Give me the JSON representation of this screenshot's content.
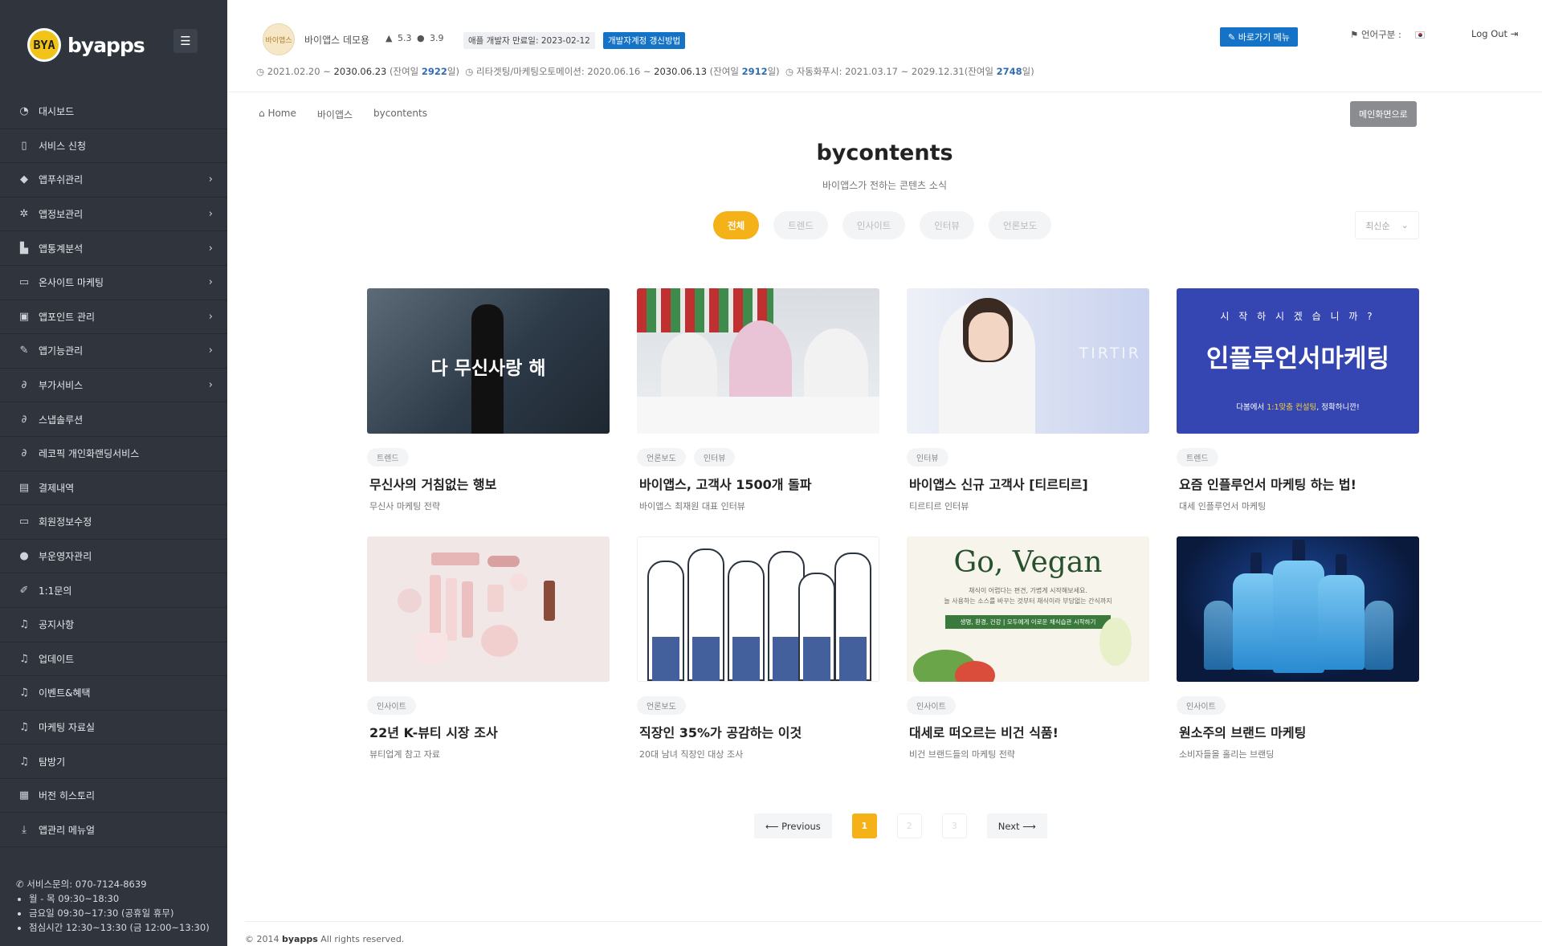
{
  "brand": {
    "logo_mark": "BYA",
    "logo_text": "byapps"
  },
  "sidebar": {
    "items": [
      {
        "label": "대시보드",
        "icon": "dashboard-icon",
        "glyph": "◔",
        "has_children": false
      },
      {
        "label": "서비스 신청",
        "icon": "phone-icon",
        "glyph": "▯",
        "has_children": false
      },
      {
        "label": "앱푸쉬관리",
        "icon": "megaphone-icon",
        "glyph": "◆",
        "has_children": true
      },
      {
        "label": "앱정보관리",
        "icon": "gear-icon",
        "glyph": "✲",
        "has_children": true
      },
      {
        "label": "앱통계분석",
        "icon": "chart-icon",
        "glyph": "▙",
        "has_children": true
      },
      {
        "label": "온사이트 마케팅",
        "icon": "laptop-icon",
        "glyph": "▭",
        "has_children": true
      },
      {
        "label": "앱포인트 관리",
        "icon": "gift-icon",
        "glyph": "▣",
        "has_children": true
      },
      {
        "label": "앱기능관리",
        "icon": "wrench-icon",
        "glyph": "✎",
        "has_children": true
      },
      {
        "label": "부가서비스",
        "icon": "paperclip-icon",
        "glyph": "∂",
        "has_children": true
      },
      {
        "label": "스냅솔루션",
        "icon": "paperclip-icon",
        "glyph": "∂",
        "has_children": false
      },
      {
        "label": "레코픽 개인화랜딩서비스",
        "icon": "paperclip-icon",
        "glyph": "∂",
        "has_children": false
      },
      {
        "label": "결제내역",
        "icon": "receipt-icon",
        "glyph": "▤",
        "has_children": false
      },
      {
        "label": "회원정보수정",
        "icon": "card-icon",
        "glyph": "▭",
        "has_children": false
      },
      {
        "label": "부운영자관리",
        "icon": "user-icon",
        "glyph": "●",
        "has_children": false
      },
      {
        "label": "1:1문의",
        "icon": "pencil-icon",
        "glyph": "✐",
        "has_children": false
      },
      {
        "label": "공지사항",
        "icon": "microphone-icon",
        "glyph": "♫",
        "has_children": false
      },
      {
        "label": "업데이트",
        "icon": "microphone-icon",
        "glyph": "♫",
        "has_children": false
      },
      {
        "label": "이벤트&혜택",
        "icon": "microphone-icon",
        "glyph": "♫",
        "has_children": false
      },
      {
        "label": "마케팅 자료실",
        "icon": "microphone-icon",
        "glyph": "♫",
        "has_children": false
      },
      {
        "label": "탐방기",
        "icon": "microphone-icon",
        "glyph": "♫",
        "has_children": false
      },
      {
        "label": "버전 히스토리",
        "icon": "archive-icon",
        "glyph": "▦",
        "has_children": false
      },
      {
        "label": "앱관리 메뉴얼",
        "icon": "download-icon",
        "glyph": "⤓",
        "has_children": false
      }
    ],
    "support_phone": "서비스문의: 070-7124-8639",
    "hours": [
      "월 - 목 09:30~18:30",
      "금요일 09:30~17:30 (공휴일 휴무)",
      "점심시간 12:30~13:30 (금 12:00~13:30)"
    ]
  },
  "header": {
    "app_thumb_text": "바이앱스",
    "app_name": "바이앱스 데모용",
    "android_version": "5.3",
    "ios_version": "3.9",
    "apple_dev_expiry": "애플 개발자 만료일: 2023-02-12",
    "renew_label": "개발자계정 갱신방법",
    "shortcut_label": "바로가기 메뉴",
    "lang_label": "언어구분 :",
    "logout_label": "Log Out",
    "dates": {
      "service_prefix": "2021.02.20 ~ ",
      "service_end": "2030.06.23",
      "service_mid": " (잔여일 ",
      "service_days": "2922",
      "service_suffix": "일)",
      "retarget_prefix": "리타겟팅/마케팅오토메이션: 2020.06.16 ~ ",
      "retarget_end": "2030.06.13",
      "retarget_mid": " (잔여일 ",
      "retarget_days": "2912",
      "retarget_suffix": "일)",
      "auto_prefix": "자동화푸시: 2021.03.17 ~ 2029.12.31(잔여일 ",
      "auto_days": "2748",
      "auto_suffix": "일)"
    }
  },
  "breadcrumb": [
    "Home",
    "바이앱스",
    "bycontents"
  ],
  "main_button": "메인화면으로",
  "page": {
    "title": "bycontents",
    "subtitle": "바이앱스가 전하는 콘텐츠 소식"
  },
  "filters": [
    {
      "label": "전체",
      "active": true
    },
    {
      "label": "트렌드",
      "active": false
    },
    {
      "label": "인사이트",
      "active": false
    },
    {
      "label": "인터뷰",
      "active": false
    },
    {
      "label": "언론보도",
      "active": false
    }
  ],
  "sort": {
    "selected": "최신순"
  },
  "cards": [
    {
      "tags": [
        "트렌드"
      ],
      "title": "무신사의 거침없는 행보",
      "subtitle": "무신사 마케팅 전략",
      "image_text": "다 무신사랑 해"
    },
    {
      "tags": [
        "언론보도",
        "인터뷰"
      ],
      "title": "바이앱스, 고객사 1500개 돌파",
      "subtitle": "바이앱스 최재원 대표 인터뷰"
    },
    {
      "tags": [
        "인터뷰"
      ],
      "title": "바이앱스 신규 고객사 [티르티르]",
      "subtitle": "티르티르 인터뷰",
      "image_text": "TIRTIR"
    },
    {
      "tags": [
        "트렌드"
      ],
      "title": "요즘 인플루언서 마케팅 하는 법!",
      "subtitle": "대세 인플루언서 마케팅",
      "image_q": "시 작 하 시 겠 습 니 까 ?",
      "image_big": "인플루언서마케팅",
      "image_small_a": "다봄에서 ",
      "image_small_b": "1:1맞춤 컨설팅",
      "image_small_c": ", 정확하니깐!"
    },
    {
      "tags": [
        "인사이트"
      ],
      "title": "22년 K-뷰티 시장 조사",
      "subtitle": "뷰티업계 참고 자료"
    },
    {
      "tags": [
        "언론보도"
      ],
      "title": "직장인 35%가 공감하는 이것",
      "subtitle": "20대 남녀 직장인 대상 조사"
    },
    {
      "tags": [
        "인사이트"
      ],
      "title": "대세로 떠오르는 비건 식품!",
      "subtitle": "비건 브랜드들의 마케팅 전략",
      "image_go": "Go, Vegan",
      "image_line1": "채식이 어렵다는 편견, 가볍게 시작해보세요.",
      "image_line2": "늘 사용하는 소스를 바꾸는 것부터 채식이라 부담없는 간식까지",
      "image_bar": "생명, 환경, 건강 | 모두에게 이로운 채식습관 시작하기"
    },
    {
      "tags": [
        "인사이트"
      ],
      "title": "원소주의 브랜드 마케팅",
      "subtitle": "소비자들을 홀리는 브랜딩"
    }
  ],
  "pagination": {
    "prev": "Previous",
    "next": "Next",
    "pages": [
      "1",
      "2",
      "3"
    ],
    "current": "1"
  },
  "footer": {
    "copy_prefix": "© 2014 ",
    "brand": "byapps",
    "copy_suffix": " All rights reserved."
  },
  "colors": {
    "sidebar_bg": "#2f343d",
    "accent": "#f4b118",
    "blue": "#1473c6"
  }
}
